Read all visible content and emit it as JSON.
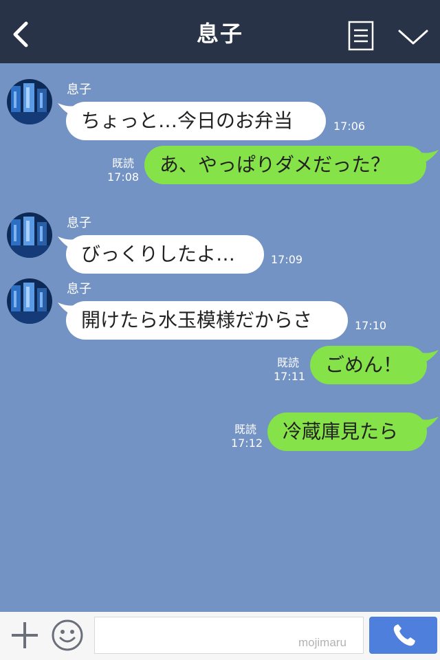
{
  "header": {
    "title": "息子",
    "icons": {
      "back": "chevron-left-icon",
      "notes": "notes-icon",
      "collapse": "chevron-down-icon"
    }
  },
  "messages": [
    {
      "direction": "in",
      "sender": "息子",
      "text": "ちょっと…今日のお弁当",
      "time": "17:06"
    },
    {
      "direction": "out",
      "read": "既読",
      "text": "あ、やっぱりダメだった？",
      "time": "17:08"
    },
    {
      "direction": "in",
      "sender": "息子",
      "text": "びっくりしたよ…",
      "time": "17:09"
    },
    {
      "direction": "in",
      "sender": "息子",
      "text": "開けたら水玉模様だからさ",
      "time": "17:10"
    },
    {
      "direction": "out",
      "read": "既読",
      "text": "ごめん！",
      "time": "17:11"
    },
    {
      "direction": "out",
      "read": "既読",
      "text": "冷蔵庫見たら",
      "time": "17:12"
    }
  ],
  "input_bar": {
    "placeholder": "",
    "watermark": "mojimaru",
    "icons": {
      "plus": "plus-icon",
      "emoji": "smiley-icon",
      "call": "phone-icon"
    }
  },
  "colors": {
    "header_bg": "#283347",
    "chat_bg": "#7393c4",
    "incoming_bubble": "#ffffff",
    "outgoing_bubble": "#85e249",
    "call_button": "#4f7fdc"
  }
}
